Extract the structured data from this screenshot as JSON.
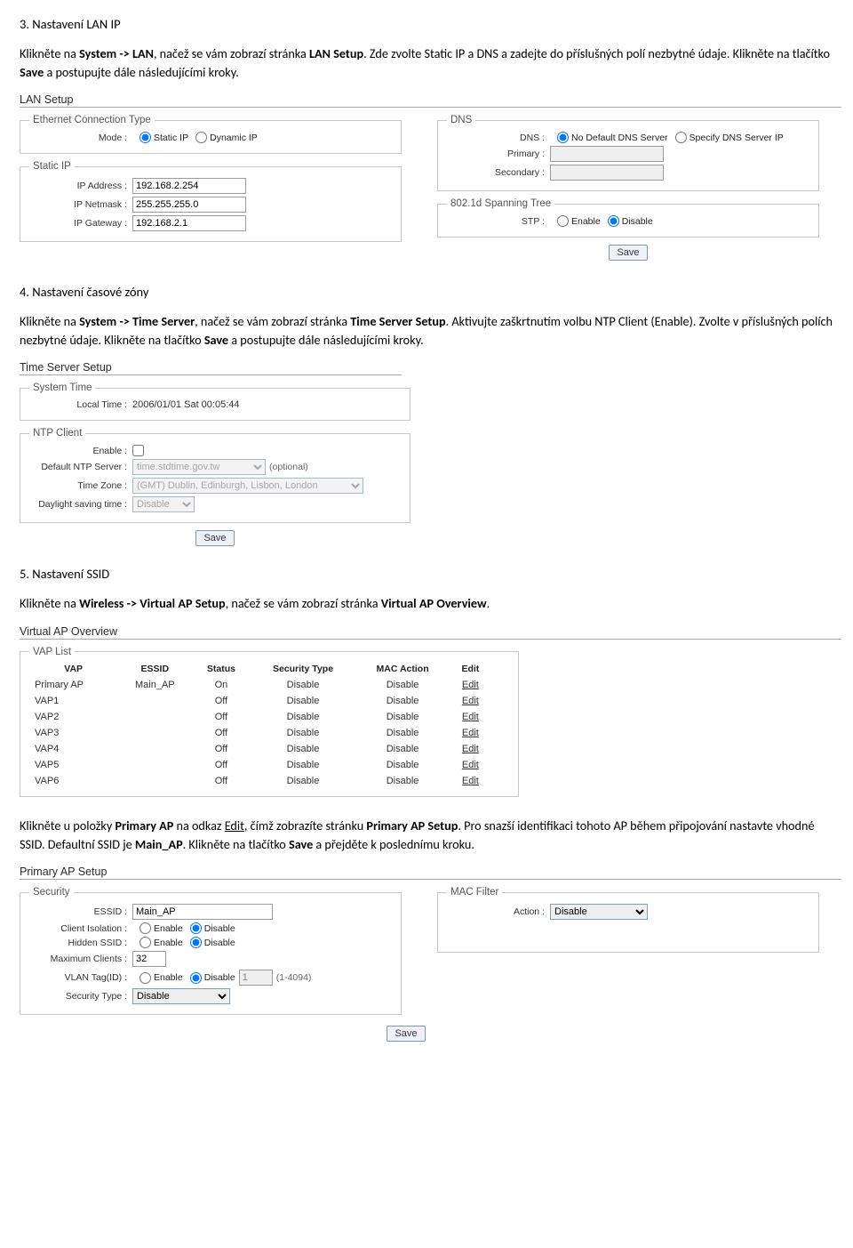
{
  "sec3": {
    "heading": "3. Nastavení LAN IP",
    "para": "Klikněte na System -> LAN, načež se vám zobrazí stránka LAN Setup. Zde zvolte Static IP a DNS a zadejte do příslušných polí nezbytné údaje. Klikněte na tlačítko Save a postupujte dále následujícími kroky.",
    "p_plain_pre": "Klikněte na ",
    "p_b1": "System -> LAN",
    "p_mid1": ", načež se vám zobrazí stránka ",
    "p_b2": "LAN Setup",
    "p_mid2": ". Zde zvolte Static IP a DNS a zadejte do příslušných polí nezbytné údaje. Klikněte na tlačítko ",
    "p_b3": "Save",
    "p_end": " a postupujte dále následujícími kroky."
  },
  "lan": {
    "title": "LAN Setup",
    "eth_legend": "Ethernet Connection Type",
    "mode_label": "Mode :",
    "mode_static": "Static IP",
    "mode_dynamic": "Dynamic IP",
    "static_legend": "Static IP",
    "ip_label": "IP Address :",
    "ip_value": "192.168.2.254",
    "netmask_label": "IP Netmask :",
    "netmask_value": "255.255.255.0",
    "gw_label": "IP Gateway :",
    "gw_value": "192.168.2.1",
    "dns_legend": "DNS",
    "dns_label": "DNS :",
    "dns_nodef": "No Default DNS Server",
    "dns_spec": "Specify DNS Server IP",
    "primary_label": "Primary :",
    "secondary_label": "Secondary :",
    "stp_legend": "802.1d Spanning Tree",
    "stp_label": "STP :",
    "enable": "Enable",
    "disable": "Disable",
    "save": "Save"
  },
  "sec4": {
    "heading": "4. Nastavení časové zóny",
    "p_pre": "Klikněte na ",
    "p_b1": "System -> Time Server",
    "p_mid1": ", načež se vám zobrazí stránka ",
    "p_b2": "Time Server Setup",
    "p_mid2": ". Aktivujte zaškrtnutím volbu NTP Client (Enable). Zvolte v příslušných polích nezbytné údaje. Klikněte na tlačítko ",
    "p_b3": "Save",
    "p_end": " a postupujte dále následujícími kroky."
  },
  "ts": {
    "title": "Time Server Setup",
    "systime_legend": "System Time",
    "localtime_label": "Local Time :",
    "localtime_value": "2006/01/01 Sat 00:05:44",
    "ntp_legend": "NTP Client",
    "enable_label": "Enable :",
    "defntp_label": "Default NTP Server :",
    "defntp_value": "time.stdtime.gov.tw",
    "optional": "(optional)",
    "tz_label": "Time Zone :",
    "tz_value": "(GMT) Dublin, Edinburgh, Lisbon, London",
    "dst_label": "Daylight saving time :",
    "dst_value": "Disable",
    "save": "Save"
  },
  "sec5": {
    "heading": "5. Nastavení SSID",
    "p_pre": "Klikněte na ",
    "p_b1": "Wireless -> Virtual AP Setup",
    "p_mid1": ", načež se vám zobrazí stránka ",
    "p_b2": "Virtual AP Overview",
    "p_end": "."
  },
  "vap": {
    "title": "Virtual AP Overview",
    "legend": "VAP List",
    "headers": {
      "vap": "VAP",
      "essid": "ESSID",
      "status": "Status",
      "sec": "Security Type",
      "mac": "MAC Action",
      "edit": "Edit"
    },
    "rows": [
      {
        "vap": "Primary AP",
        "essid": "Main_AP",
        "status": "On",
        "sec": "Disable",
        "mac": "Disable",
        "edit": "Edit"
      },
      {
        "vap": "VAP1",
        "essid": "",
        "status": "Off",
        "sec": "Disable",
        "mac": "Disable",
        "edit": "Edit"
      },
      {
        "vap": "VAP2",
        "essid": "",
        "status": "Off",
        "sec": "Disable",
        "mac": "Disable",
        "edit": "Edit"
      },
      {
        "vap": "VAP3",
        "essid": "",
        "status": "Off",
        "sec": "Disable",
        "mac": "Disable",
        "edit": "Edit"
      },
      {
        "vap": "VAP4",
        "essid": "",
        "status": "Off",
        "sec": "Disable",
        "mac": "Disable",
        "edit": "Edit"
      },
      {
        "vap": "VAP5",
        "essid": "",
        "status": "Off",
        "sec": "Disable",
        "mac": "Disable",
        "edit": "Edit"
      },
      {
        "vap": "VAP6",
        "essid": "",
        "status": "Off",
        "sec": "Disable",
        "mac": "Disable",
        "edit": "Edit"
      }
    ]
  },
  "sec5b": {
    "p_pre": "Klikněte u položky ",
    "p_b1": "Primary AP",
    "p_mid1": " na odkaz ",
    "p_u1": "Edit",
    "p_mid2": ", čímž zobrazíte stránku ",
    "p_b2": "Primary AP Setup",
    "p_mid3": ". Pro snazší identifikaci tohoto AP během připojování nastavte vhodné SSID. Defaultní SSID je ",
    "p_b3": "Main_AP",
    "p_mid4": ". Klikněte na tlačítko ",
    "p_b4": "Save",
    "p_end": " a přejděte k poslednímu kroku."
  },
  "pap": {
    "title": "Primary AP Setup",
    "sec_legend": "Security",
    "essid_label": "ESSID :",
    "essid_value": "Main_AP",
    "iso_label": "Client Isolation :",
    "hidden_label": "Hidden SSID :",
    "max_label": "Maximum Clients :",
    "max_value": "32",
    "vlan_label": "VLAN Tag(ID) :",
    "vlan_value": "1",
    "vlan_range": "(1-4094)",
    "sectype_label": "Security Type :",
    "sectype_value": "Disable",
    "enable": "Enable",
    "disable": "Disable",
    "mac_legend": "MAC Filter",
    "action_label": "Action :",
    "action_value": "Disable",
    "save": "Save"
  }
}
